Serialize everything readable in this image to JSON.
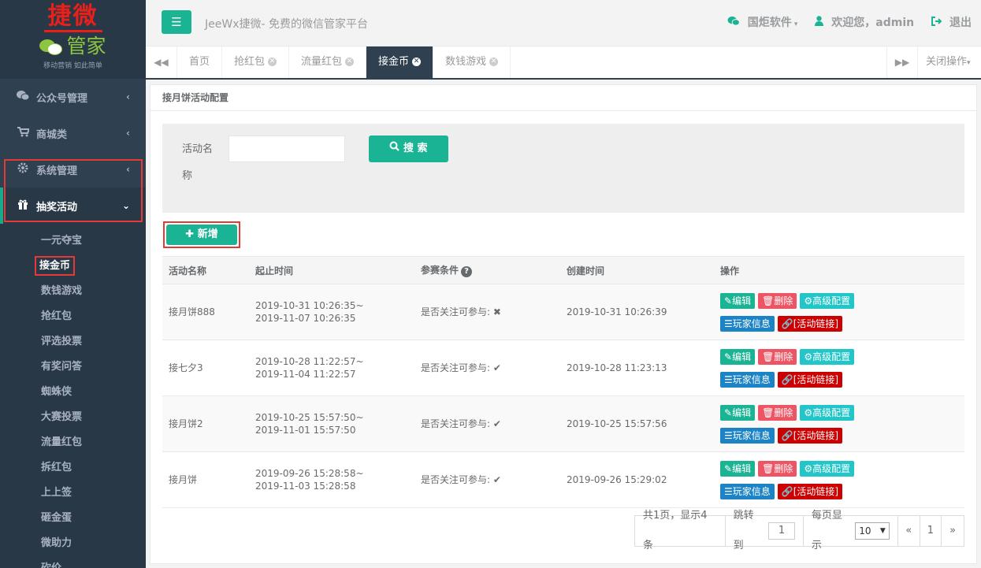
{
  "logo": {
    "title": "捷微",
    "subtitle": "管家",
    "slogan": "移动营销 如此简单"
  },
  "sidebar": {
    "items": [
      {
        "label": "公众号管理",
        "icon": "wechat-icon",
        "arrow": "‹"
      },
      {
        "label": "商城类",
        "icon": "cart-icon",
        "arrow": "‹"
      },
      {
        "label": "系统管理",
        "icon": "gear-icon",
        "arrow": "‹"
      },
      {
        "label": "抽奖活动",
        "icon": "gift-icon",
        "arrow": "⌄"
      }
    ],
    "subitems": [
      "一元夺宝",
      "接金币",
      "数钱游戏",
      "抢红包",
      "评选投票",
      "有奖问答",
      "蜘蛛侠",
      "大赛投票",
      "流量红包",
      "拆红包",
      "上上签",
      "砸金蛋",
      "微助力",
      "砍价"
    ]
  },
  "header": {
    "site_title": "JeeWx捷微- 免费的微信管家平台",
    "company": "国炬软件",
    "welcome": "欢迎您，admin",
    "logout": "退出"
  },
  "tabs": {
    "items": [
      "首页",
      "抢红包",
      "流量红包",
      "接金币",
      "数钱游戏"
    ],
    "active": "接金币",
    "close_ops": "关闭操作"
  },
  "panel": {
    "title": "接月饼活动配置",
    "search_label": "活动名称",
    "search_value": "",
    "search_button": "搜 索",
    "add_button": "新增"
  },
  "table": {
    "headers": [
      "活动名称",
      "起止时间",
      "参赛条件",
      "创建时间",
      "操作"
    ],
    "rows": [
      {
        "name": "接月饼888",
        "start": "2019-10-31 10:26:35~",
        "end": "2019-11-07 10:26:35",
        "cond": "是否关注可参与:",
        "mark": "✖",
        "created": "2019-10-31 10:26:39"
      },
      {
        "name": "接七夕3",
        "start": "2019-10-28 11:22:57~",
        "end": "2019-11-04 11:22:57",
        "cond": "是否关注可参与:",
        "mark": "✔",
        "created": "2019-10-28 11:23:13"
      },
      {
        "name": "接月饼2",
        "start": "2019-10-25 15:57:50~",
        "end": "2019-11-01 15:57:50",
        "cond": "是否关注可参与:",
        "mark": "✔",
        "created": "2019-10-25 15:57:56"
      },
      {
        "name": "接月饼",
        "start": "2019-09-26 15:28:58~",
        "end": "2019-11-03 15:28:58",
        "cond": "是否关注可参与:",
        "mark": "✔",
        "created": "2019-09-26 15:29:02"
      }
    ],
    "actions": {
      "edit": "编辑",
      "delete": "删除",
      "advanced": "高级配置",
      "players": "玩家信息",
      "link": "[活动链接]"
    }
  },
  "pager": {
    "summary": "共1页，显示4条",
    "jump_label": "跳转到",
    "jump_value": "1",
    "per_page_label": "每页显示",
    "per_page_value": "10",
    "prev": "«",
    "page": "1",
    "next": "»"
  },
  "colors": {
    "sidebar": "#2f4050",
    "primary": "#1ab394",
    "danger": "#ed5565",
    "info": "#23c6c8",
    "blue": "#1c84c6",
    "link_red": "#cc0000",
    "highlight_box": "#e53935"
  }
}
